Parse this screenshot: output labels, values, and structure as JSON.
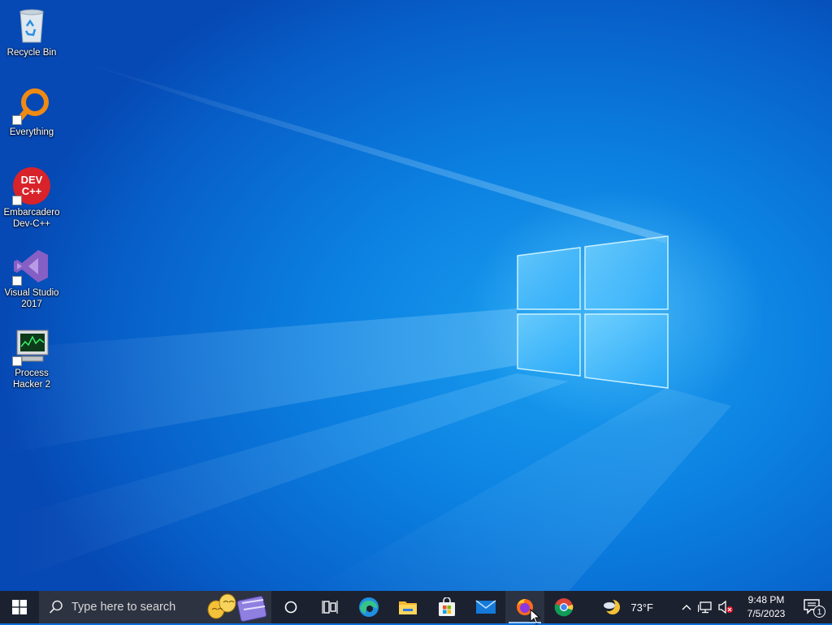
{
  "desktop": {
    "icons": [
      {
        "label": "Recycle Bin",
        "icon": "recycle-bin-icon"
      },
      {
        "label": "Everything",
        "icon": "everything-search-icon"
      },
      {
        "label": "Embarcadero Dev-C++",
        "icon": "devcpp-icon",
        "badge_text": "DEV\nC++"
      },
      {
        "label": "Visual Studio 2017",
        "icon": "visual-studio-icon"
      },
      {
        "label": "Process Hacker 2",
        "icon": "process-hacker-icon"
      }
    ]
  },
  "taskbar": {
    "search_placeholder": "Type here to search",
    "pinned": [
      {
        "name": "cortana",
        "icon": "circle-icon"
      },
      {
        "name": "task-view",
        "icon": "task-view-icon"
      },
      {
        "name": "edge",
        "icon": "edge-icon"
      },
      {
        "name": "file-explorer",
        "icon": "folder-icon"
      },
      {
        "name": "microsoft-store",
        "icon": "store-icon"
      },
      {
        "name": "mail",
        "icon": "mail-icon"
      },
      {
        "name": "firefox",
        "icon": "firefox-icon",
        "active": true
      },
      {
        "name": "chrome",
        "icon": "chrome-icon"
      }
    ],
    "weather": {
      "temp": "73°F",
      "icon": "weather-moon-cloud-icon"
    },
    "clock": {
      "time": "9:48 PM",
      "date": "7/5/2023"
    },
    "notifications": {
      "count": "1"
    }
  },
  "colors": {
    "taskbar_bg": "#1c2130",
    "desktop_blue": "#0b7fe0",
    "accent_light": "#9fc7ff"
  }
}
